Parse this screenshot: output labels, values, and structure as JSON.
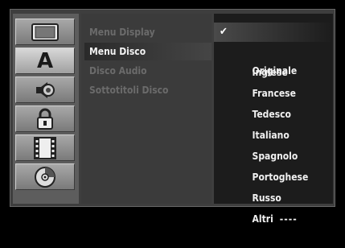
{
  "icons": [
    {
      "name": "display-icon",
      "active": false
    },
    {
      "name": "language-icon",
      "glyph": "A",
      "active": true
    },
    {
      "name": "speaker-icon",
      "active": false
    },
    {
      "name": "lock-icon",
      "active": false
    },
    {
      "name": "film-icon",
      "active": false
    },
    {
      "name": "disc-icon",
      "active": false
    }
  ],
  "menu": {
    "items": [
      {
        "label": "Menu Display",
        "selected": false
      },
      {
        "label": "Menu Disco",
        "selected": true
      },
      {
        "label": "Disco Audio",
        "selected": false
      },
      {
        "label": "Sottotitoli Disco",
        "selected": false
      }
    ]
  },
  "options": {
    "check_glyph": "✔",
    "items": [
      {
        "label": "Originale",
        "checked": true
      },
      {
        "label": "Inglese",
        "checked": false
      },
      {
        "label": "Francese",
        "checked": false
      },
      {
        "label": "Tedesco",
        "checked": false
      },
      {
        "label": "Italiano",
        "checked": false
      },
      {
        "label": "Spagnolo",
        "checked": false
      },
      {
        "label": "Portoghese",
        "checked": false
      },
      {
        "label": "Russo",
        "checked": false
      },
      {
        "label": "Altri",
        "checked": false,
        "value": "----"
      }
    ]
  }
}
